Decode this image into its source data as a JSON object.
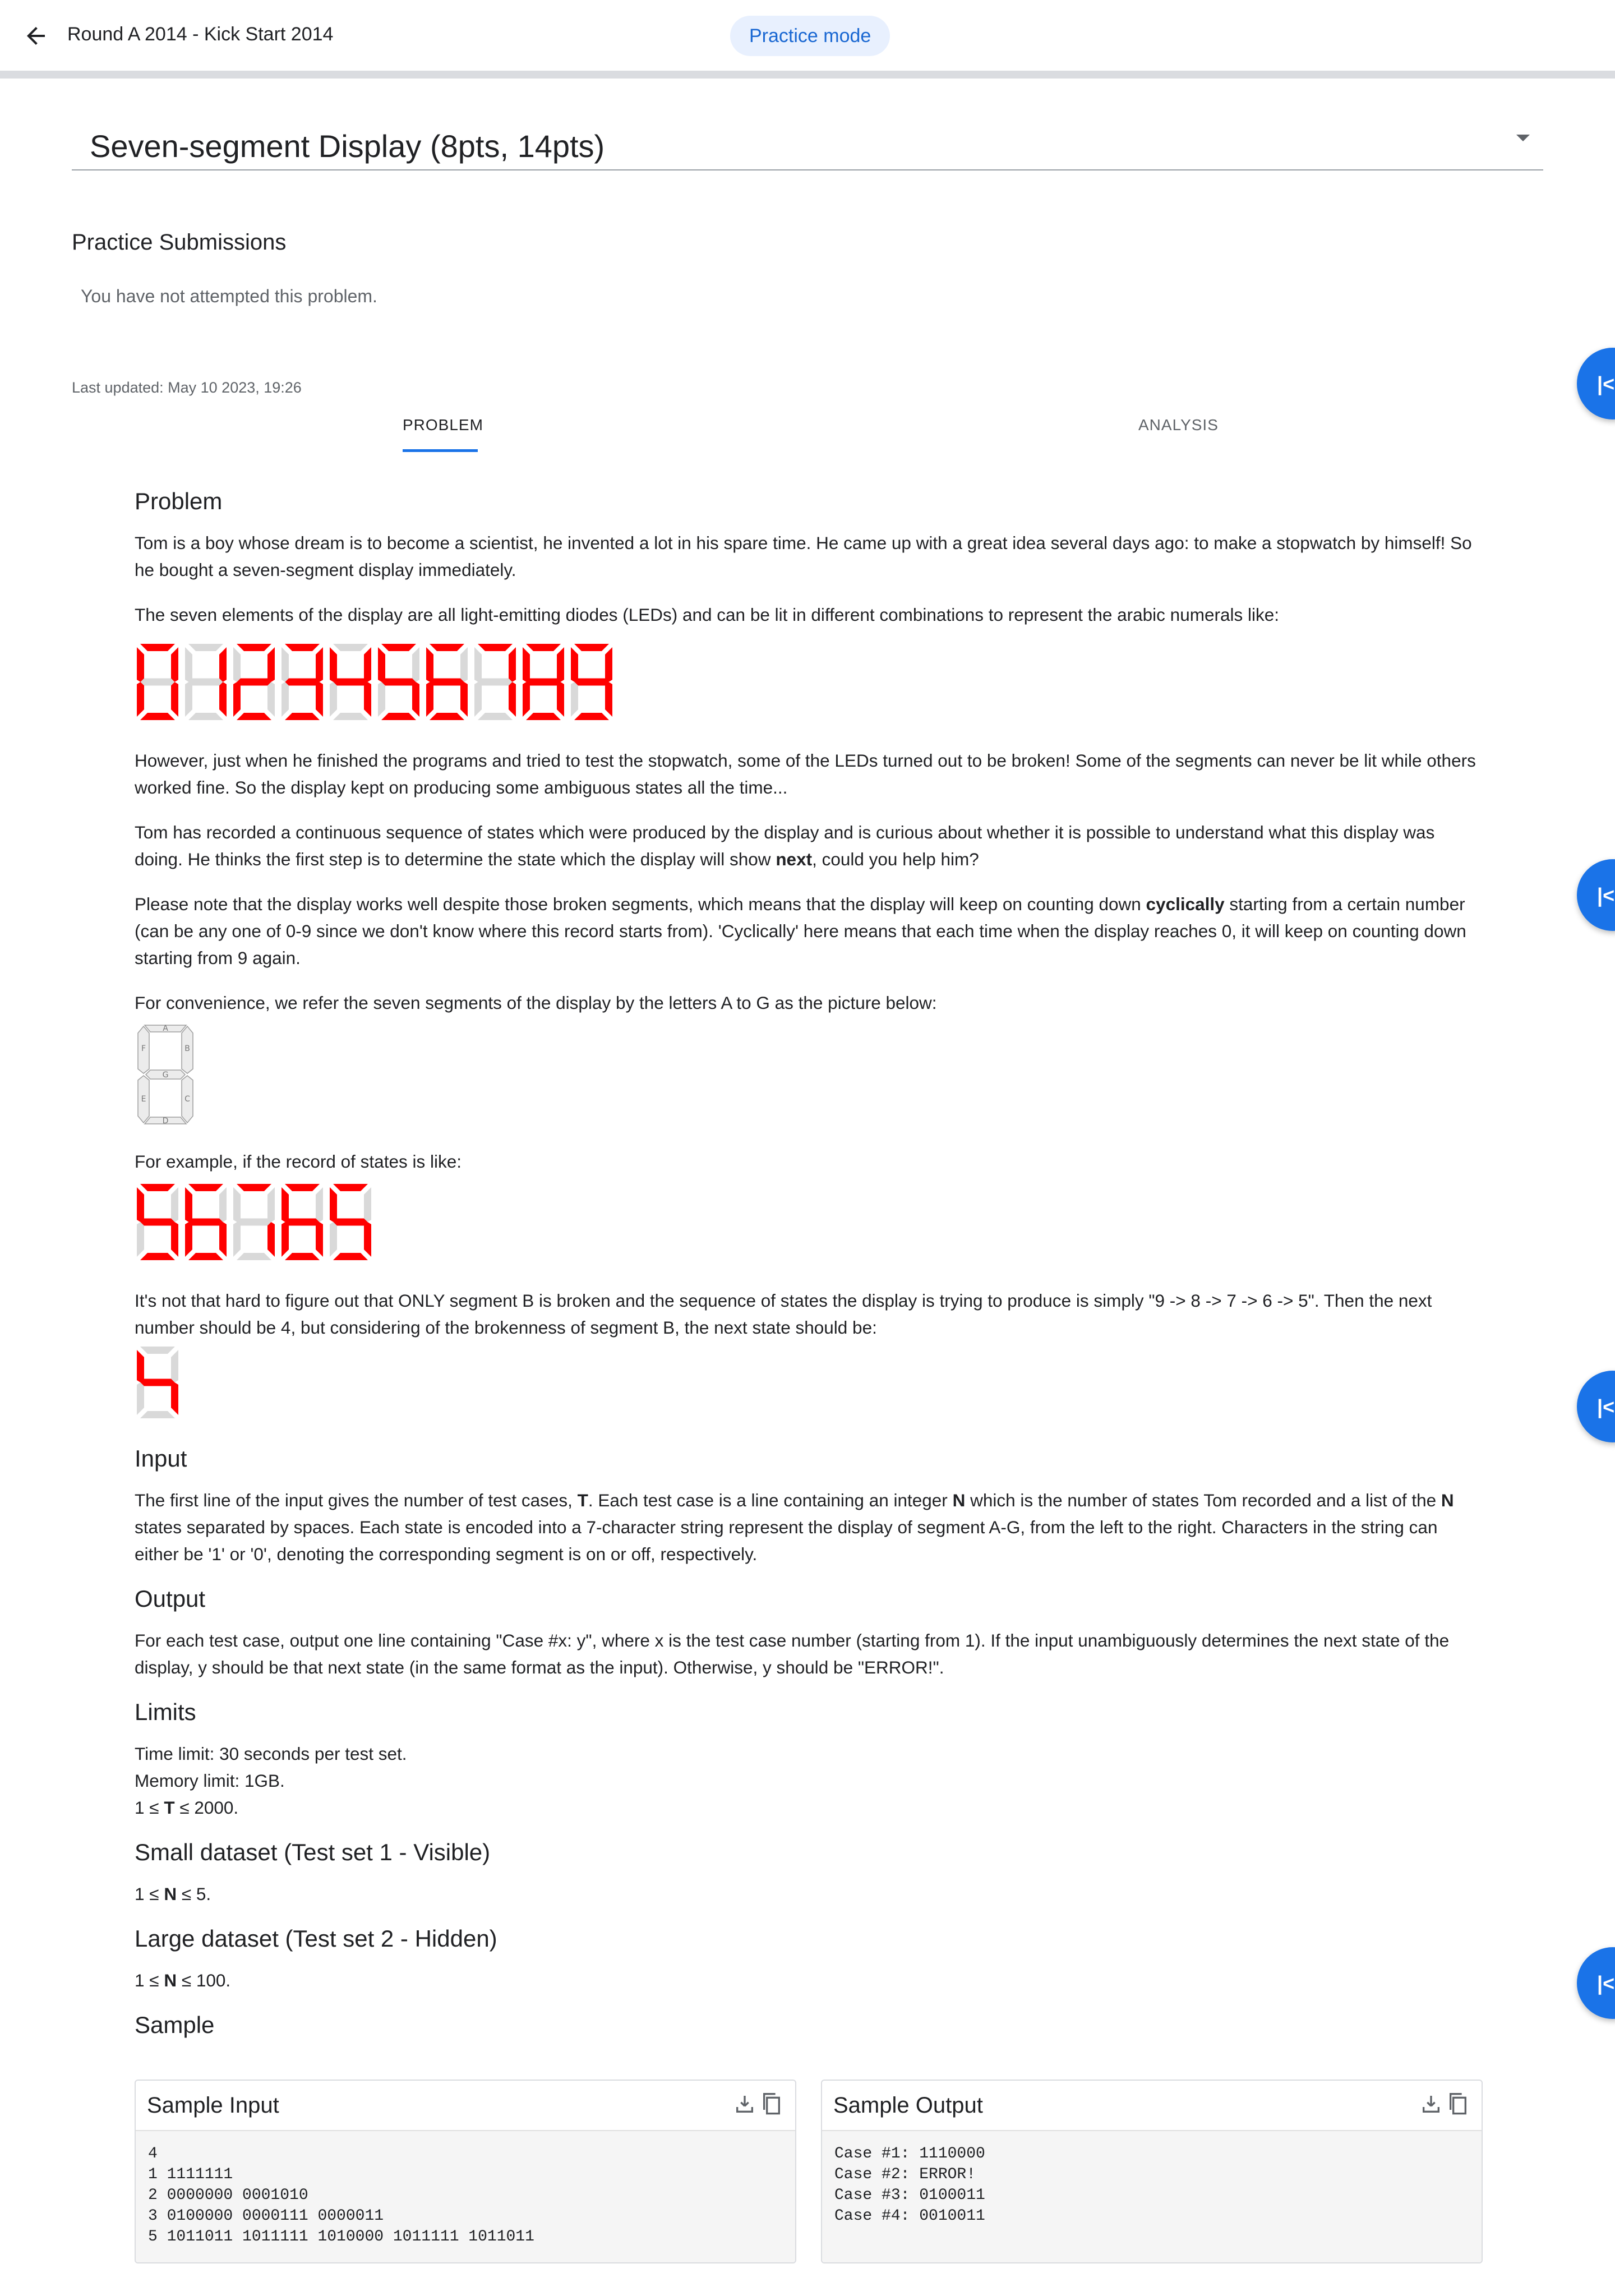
{
  "topbar": {
    "contest_title": "Round A 2014 - Kick Start 2014",
    "mode_chip": "Practice mode"
  },
  "problem_selector": {
    "selected": "Seven-segment Display (8pts, 14pts)"
  },
  "submissions": {
    "title": "Practice Submissions",
    "empty_text": "You have not attempted this problem."
  },
  "last_updated": "Last updated: May 10 2023, 19:26",
  "tabs": [
    {
      "label": "PROBLEM",
      "active": true
    },
    {
      "label": "ANALYSIS",
      "active": false
    }
  ],
  "statement": {
    "heading_problem": "Problem",
    "p1": "Tom is a boy whose dream is to become a scientist, he invented a lot in his spare time. He came up with a great idea several days ago: to make a stopwatch by himself! So he bought a seven-segment display immediately.",
    "p2": "The seven elements of the display are all light-emitting diodes (LEDs) and can be lit in different combinations to represent the arabic numerals like:",
    "digits_row": [
      "0",
      "1",
      "2",
      "3",
      "4",
      "5",
      "6",
      "7",
      "8",
      "9"
    ],
    "p3": "However, just when he finished the programs and tried to test the stopwatch, some of the LEDs turned out to be broken! Some of the segments can never be lit while others worked fine. So the display kept on producing some ambiguous states all the time...",
    "p4_a": "Tom has recorded a continuous sequence of states which were produced by the display and is curious about whether it is possible to understand what this display was doing. He thinks the first step is to determine the state which the display will show ",
    "p4_b": "next",
    "p4_c": ", could you help him?",
    "p5_a": "Please note that the display works well despite those broken segments, which means that the display will keep on counting down ",
    "p5_b": "cyclically",
    "p5_c": " starting from a certain number (can be any one of 0-9 since we don't know where this record starts from). 'Cyclically' here means that each time when the display reaches 0, it will keep on counting down starting from 9 again.",
    "p6": "For convenience, we refer the seven segments of the display by the letters A to G as the picture below:",
    "segment_letters": [
      "A",
      "B",
      "C",
      "D",
      "E",
      "F",
      "G"
    ],
    "p7": "For example, if the record of states is like:",
    "p8": "It's not that hard to figure out that ONLY segment B is broken and the sequence of states the display is trying to produce is simply \"9 -> 8 -> 7 -> 6 -> 5\". Then the next number should be 4, but considering of the brokenness of segment B, the next state should be:",
    "heading_input": "Input",
    "input_a": "The first line of the input gives the number of test cases, ",
    "input_T": "T",
    "input_b": ". Each test case is a line containing an integer ",
    "input_N": "N",
    "input_c": " which is the number of states Tom recorded and a list of the ",
    "input_N2": "N",
    "input_d": " states separated by spaces. Each state is encoded into a 7-character string represent the display of segment A-G, from the left to the right. Characters in the string can either be '1' or '0', denoting the corresponding segment is on or off, respectively.",
    "heading_output": "Output",
    "output_text": "For each test case, output one line containing \"Case #x: y\", where x is the test case number (starting from 1). If the input unambiguously determines the next state of the display, y should be that next state (in the same format as the input). Otherwise, y should be \"ERROR!\".",
    "heading_limits": "Limits",
    "limit_time": "Time limit: 30 seconds per test set.",
    "limit_memory": "Memory limit: 1GB.",
    "limit_T_a": "1 ≤ ",
    "limit_T_b": "T",
    "limit_T_c": " ≤ 2000.",
    "heading_small": "Small dataset (Test set 1 - Visible)",
    "small_a": "1 ≤ ",
    "small_b": "N",
    "small_c": " ≤ 5.",
    "heading_large": "Large dataset (Test set 2 - Hidden)",
    "large_a": "1 ≤ ",
    "large_b": "N",
    "large_c": " ≤ 100.",
    "heading_sample": "Sample"
  },
  "sample_input": {
    "title": "Sample Input",
    "lines": [
      "4",
      "1 1111111",
      "2 0000000 0001010",
      "3 0100000 0000111 0000011",
      "5 1011011 1011111 1010000 1011111 1011011"
    ]
  },
  "sample_output": {
    "title": "Sample Output",
    "lines": [
      "Case #1: 1110000",
      "Case #2: ERROR!",
      "Case #3: 0100011",
      "Case #4: 0010011"
    ]
  },
  "colors": {
    "accent": "#1a73e8",
    "segment_on": "#ff0000",
    "segment_off": "#d9d9d9",
    "chip_bg": "#e8f0fe"
  }
}
